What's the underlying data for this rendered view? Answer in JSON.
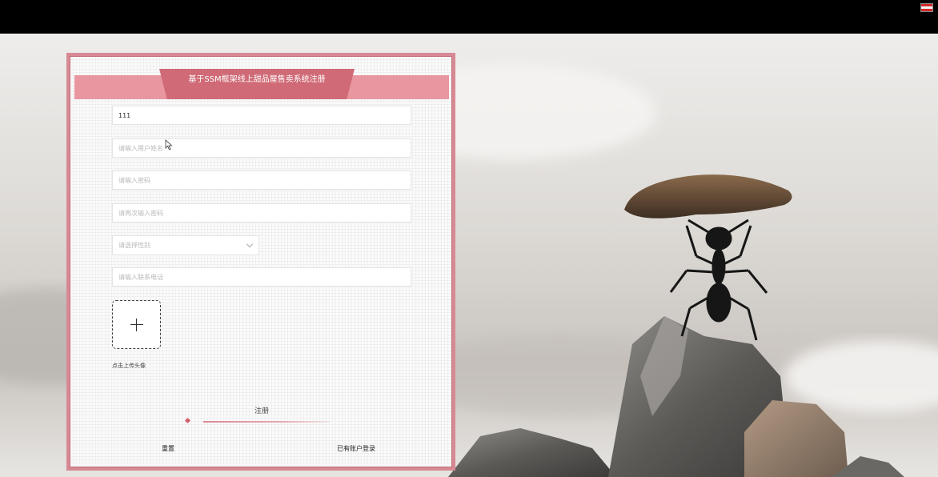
{
  "colors": {
    "panel_border": "#d78a94",
    "title_tab": "#cf6a76",
    "title_band": "#e897a0",
    "accent_diamond": "#d5606e"
  },
  "form": {
    "title": "基于SSM框架线上甜品屋售卖系统注册",
    "account_value": "111",
    "username_placeholder": "请输入用户姓名",
    "password_placeholder": "请输入密码",
    "confirm_password_placeholder": "请再次输入密码",
    "gender_placeholder": "请选择性别",
    "phone_placeholder": "请输入联系电话",
    "upload_label": "点击上传头像",
    "submit_label": "注册",
    "reset_label": "重置",
    "login_link": "已有账户登录"
  },
  "icons": [
    "flag-icon",
    "chevron-down-icon",
    "plus-icon",
    "diamond-icon",
    "cursor-icon"
  ]
}
